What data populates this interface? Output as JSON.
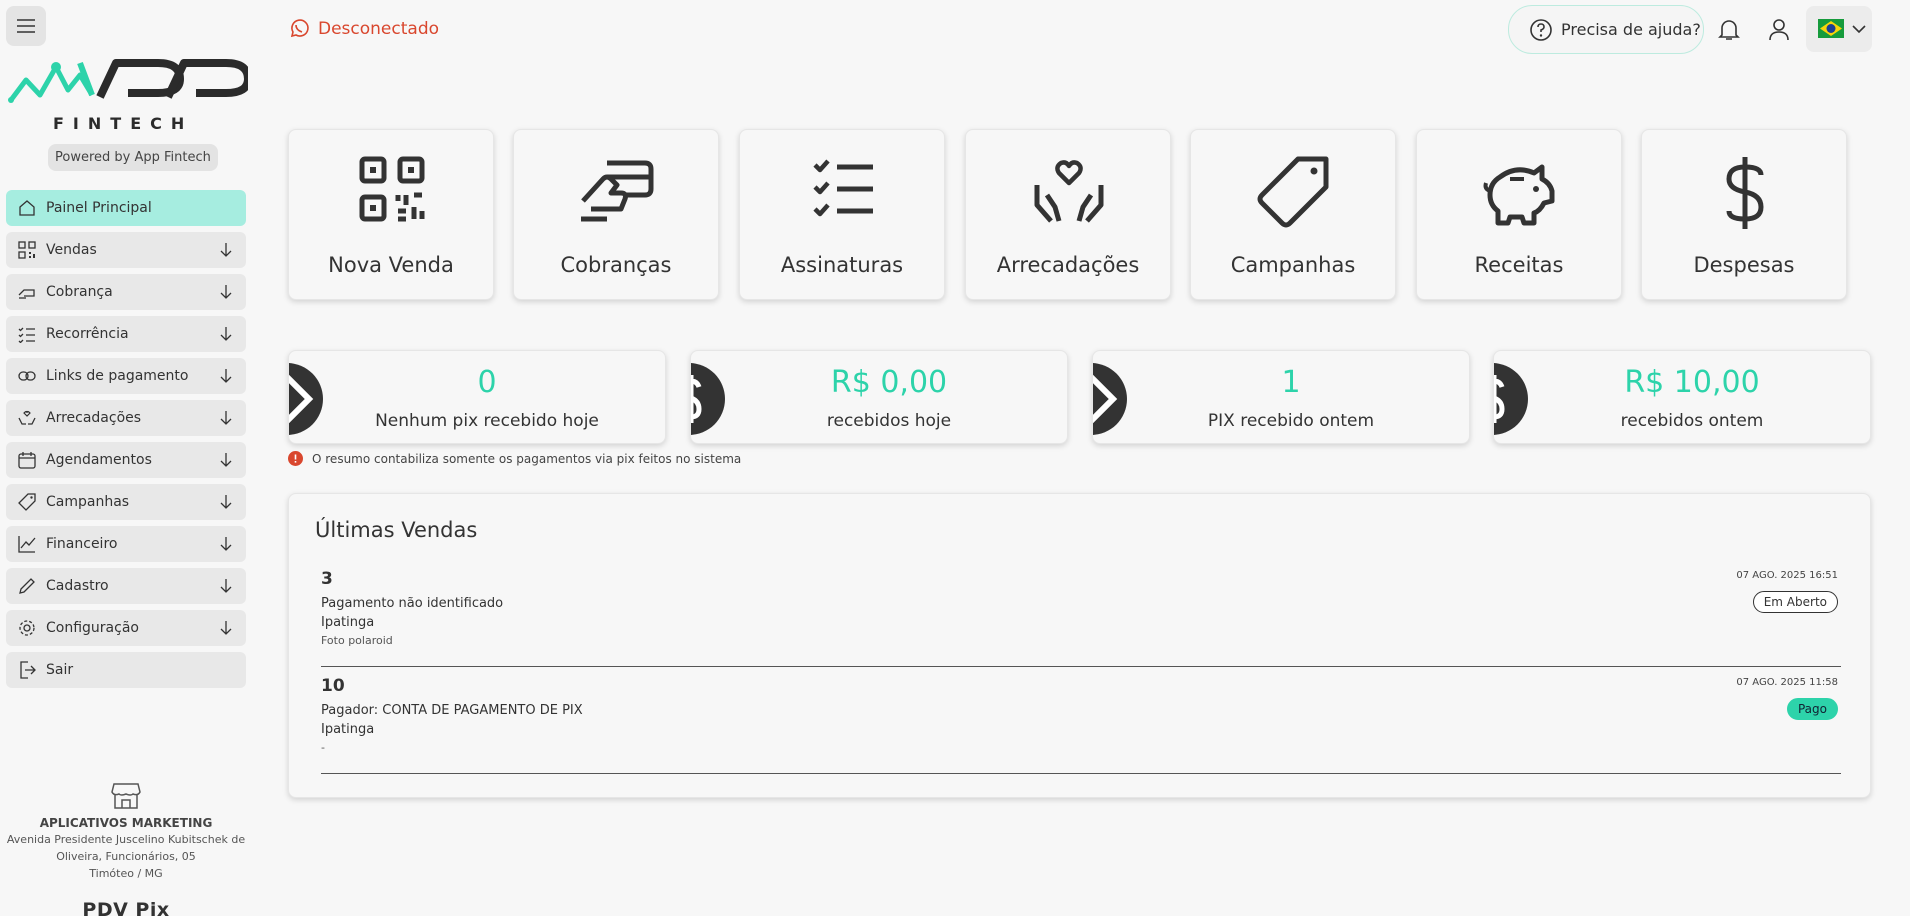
{
  "sidebar": {
    "brand_main": "APP",
    "brand_sub": "FINTECH",
    "powered_by": "Powered by App Fintech",
    "items": [
      {
        "label": "Painel Principal",
        "icon": "home-icon",
        "has_arrow": false
      },
      {
        "label": "Vendas",
        "icon": "qr-icon",
        "has_arrow": true
      },
      {
        "label": "Cobrança",
        "icon": "card-hand-icon",
        "has_arrow": true
      },
      {
        "label": "Recorrência",
        "icon": "checklist-icon",
        "has_arrow": true
      },
      {
        "label": "Links de pagamento",
        "icon": "link-icon",
        "has_arrow": true
      },
      {
        "label": "Arrecadações",
        "icon": "hands-heart-icon",
        "has_arrow": true
      },
      {
        "label": "Agendamentos",
        "icon": "calendar-icon",
        "has_arrow": true
      },
      {
        "label": "Campanhas",
        "icon": "tag-icon",
        "has_arrow": true
      },
      {
        "label": "Financeiro",
        "icon": "chart-line-icon",
        "has_arrow": true
      },
      {
        "label": "Cadastro",
        "icon": "pencil-icon",
        "has_arrow": true
      },
      {
        "label": "Configuração",
        "icon": "gear-icon",
        "has_arrow": true
      },
      {
        "label": "Sair",
        "icon": "logout-icon",
        "has_arrow": false
      }
    ],
    "company": {
      "name": "APLICATIVOS MARKETING",
      "address_1": "Avenida Presidente Juscelino Kubitschek de",
      "address_2": "Oliveira, Funcionários, 05",
      "address_3": "Timóteo / MG",
      "pdv": "PDV Pix"
    }
  },
  "header": {
    "status": "Desconectado",
    "help": "Precisa de ajuda?",
    "language_flag": "brazil-flag-icon"
  },
  "actions": [
    {
      "label": "Nova Venda",
      "icon": "qr-code-icon"
    },
    {
      "label": "Cobranças",
      "icon": "card-hand-icon"
    },
    {
      "label": "Assinaturas",
      "icon": "checklist-icon"
    },
    {
      "label": "Arrecadações",
      "icon": "hands-heart-icon"
    },
    {
      "label": "Campanhas",
      "icon": "tag-icon"
    },
    {
      "label": "Receitas",
      "icon": "piggy-bank-icon"
    },
    {
      "label": "Despesas",
      "icon": "dollar-icon"
    }
  ],
  "stats": [
    {
      "value": "0",
      "caption": "Nenhum pix recebido hoje",
      "icon": "pix-icon"
    },
    {
      "value": "R$ 0,00",
      "caption": "recebidos hoje",
      "icon": "dollar-icon"
    },
    {
      "value": "1",
      "caption": "PIX recebido ontem",
      "icon": "pix-icon"
    },
    {
      "value": "R$ 10,00",
      "caption": "recebidos ontem",
      "icon": "dollar-icon"
    }
  ],
  "notice": "O resumo contabiliza somente os pagamentos via pix feitos no sistema",
  "sales": {
    "title": "Últimas Vendas",
    "items": [
      {
        "number": "3",
        "line1": "Pagamento não identificado",
        "line2": "Ipatinga",
        "line3": "Foto polaroid",
        "date": "07 AGO. 2025 16:51",
        "status": "Em Aberto"
      },
      {
        "number": "10",
        "line1": "Pagador: CONTA DE PAGAMENTO DE PIX",
        "line2": "Ipatinga",
        "line3": "-",
        "date": "07 AGO. 2025 11:58",
        "status": "Pago"
      }
    ]
  },
  "colors": {
    "accent": "#2dd3aa",
    "active_nav": "#a6ede0",
    "alert": "#d9472e"
  }
}
